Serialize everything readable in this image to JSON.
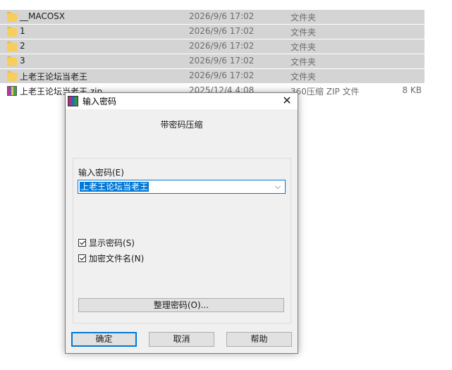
{
  "files": [
    {
      "name": "__MACOSX",
      "date": "2026/9/6 17:02",
      "type": "文件夹",
      "size": "",
      "icon": "folder-icon",
      "selected": true
    },
    {
      "name": "1",
      "date": "2026/9/6 17:02",
      "type": "文件夹",
      "size": "",
      "icon": "folder-icon",
      "selected": true
    },
    {
      "name": "2",
      "date": "2026/9/6 17:02",
      "type": "文件夹",
      "size": "",
      "icon": "folder-icon",
      "selected": true
    },
    {
      "name": "3",
      "date": "2026/9/6 17:02",
      "type": "文件夹",
      "size": "",
      "icon": "folder-icon",
      "selected": true
    },
    {
      "name": "上老王论坛当老王",
      "date": "2026/9/6 17:02",
      "type": "文件夹",
      "size": "",
      "icon": "folder-icon",
      "selected": true
    },
    {
      "name": "上老王论坛当老王.zip",
      "date": "2025/12/4 4:08",
      "type": "360压缩 ZIP 文件",
      "size": "8 KB",
      "icon": "zip-archive-icon",
      "selected": false
    }
  ],
  "dialog": {
    "title": "输入密码",
    "header": "带密码压缩",
    "password_label": "输入密码(E)",
    "password_value": "上老王论坛当老王",
    "show_password_label": "显示密码(S)",
    "show_password_checked": true,
    "encrypt_names_label": "加密文件名(N)",
    "encrypt_names_checked": true,
    "manage_button": "整理密码(O)...",
    "ok_button": "确定",
    "cancel_button": "取消",
    "help_button": "帮助"
  },
  "colors": {
    "selection": "#d4d4d4",
    "accent": "#0078d7",
    "dialog_bg": "#f0f0f0"
  }
}
